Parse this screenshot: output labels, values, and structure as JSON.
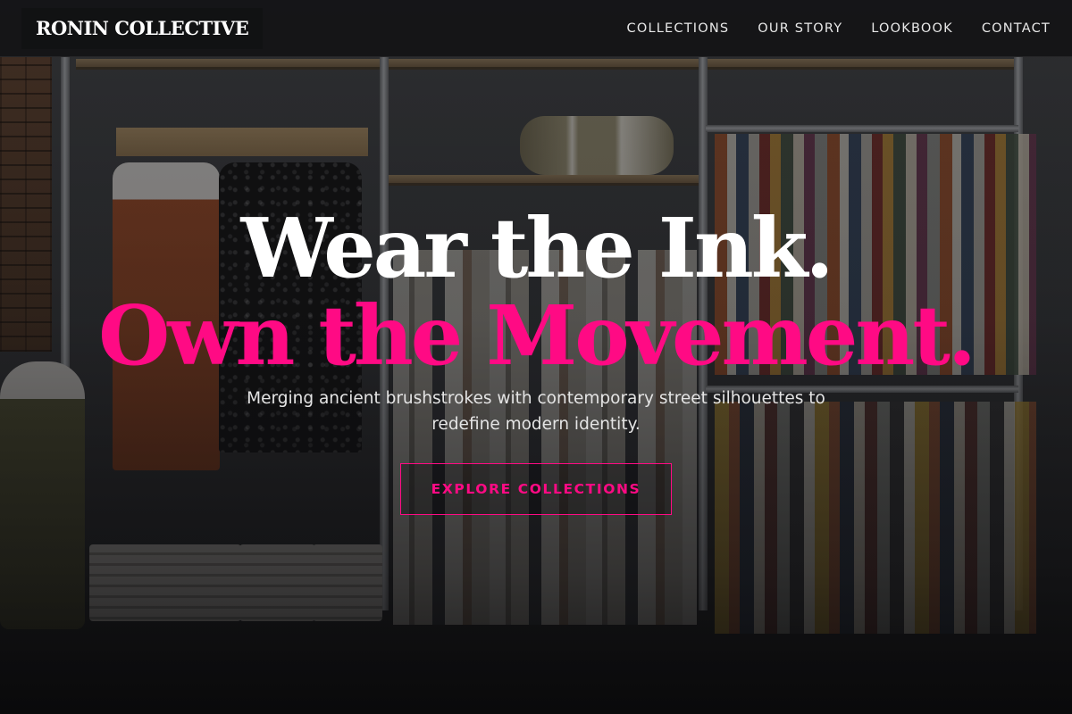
{
  "brand": {
    "name": "RONIN COLLECTIVE"
  },
  "nav": {
    "items": [
      {
        "label": "COLLECTIONS"
      },
      {
        "label": "OUR STORY"
      },
      {
        "label": "LOOKBOOK"
      },
      {
        "label": "CONTACT"
      }
    ]
  },
  "hero": {
    "headline_line1": "Wear the Ink.",
    "headline_line2": "Own the Movement.",
    "subtext": "Merging ancient brushstrokes with contemporary street silhouettes to redefine modern identity.",
    "cta_label": "EXPLORE COLLECTIONS",
    "background_image": "clothing-store-racks"
  },
  "colors": {
    "accent": "#ff0a84",
    "header_bg": "#121214",
    "text_primary": "#ffffff"
  }
}
